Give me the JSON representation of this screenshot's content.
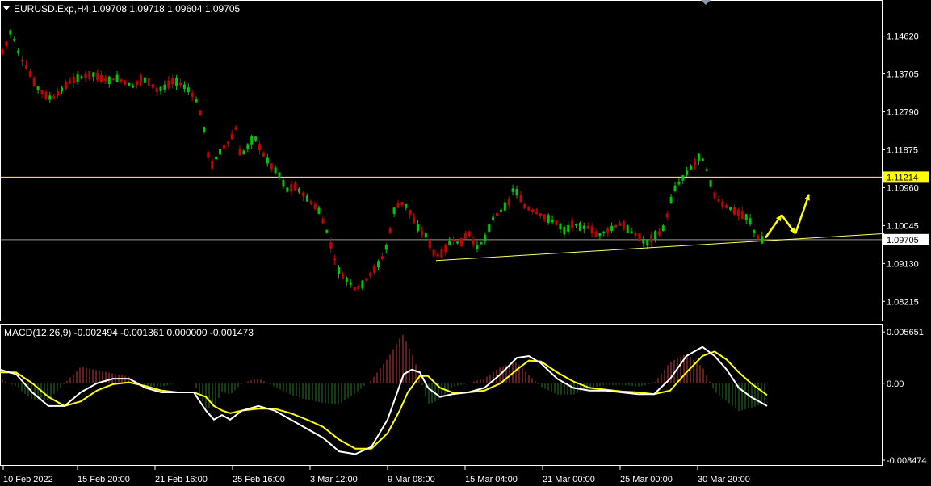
{
  "window": {
    "symbol_header": "EURUSD.Exp,H4  1.09708 1.09718 1.09604 1.09705",
    "macd_header": "MACD(12,26,9) -0.002494 -0.001361 0.000000 -0.001473"
  },
  "colors": {
    "background": "#000000",
    "bull": "#00c800",
    "bear": "#c80000",
    "support_line": "#ffff66",
    "resistance_line": "#ffff66",
    "current_price_line": "#9a9a9a",
    "arrow": "#ffff00",
    "macd_line": "#ffffff",
    "signal_line": "#ffff00",
    "hist_pos": "#c83c3c",
    "hist_neg": "#287a28"
  },
  "icons": {
    "menu_arrow": "triangle-down-icon"
  },
  "chart_data": [
    {
      "type": "candlestick",
      "symbol": "EURUSD.Exp",
      "timeframe": "H4",
      "ohlc_last": {
        "open": 1.09708,
        "high": 1.09718,
        "low": 1.09604,
        "close": 1.09705
      },
      "ylim": [
        1.0785,
        1.151
      ],
      "y_ticks": [
        "1.14620",
        "1.13705",
        "1.12790",
        "1.11875",
        "1.10960",
        "1.10045",
        "1.09130",
        "1.08215"
      ],
      "x_ticks": [
        "10 Feb 2022",
        "15 Feb 20:00",
        "21 Feb 16:00",
        "25 Feb 16:00",
        "3 Mar 12:00",
        "9 Mar 08:00",
        "15 Mar 04:00",
        "21 Mar 00:00",
        "25 Mar 00:00",
        "30 Mar 20:00"
      ],
      "price_path": [
        [
          0,
          1.143
        ],
        [
          5,
          1.142
        ],
        [
          10,
          1.146
        ],
        [
          15,
          1.148
        ],
        [
          18,
          1.145
        ],
        [
          25,
          1.141
        ],
        [
          35,
          1.138
        ],
        [
          45,
          1.134
        ],
        [
          55,
          1.132
        ],
        [
          65,
          1.131
        ],
        [
          75,
          1.133
        ],
        [
          85,
          1.135
        ],
        [
          95,
          1.136
        ],
        [
          105,
          1.1365
        ],
        [
          115,
          1.137
        ],
        [
          125,
          1.136
        ],
        [
          135,
          1.1355
        ],
        [
          145,
          1.136
        ],
        [
          155,
          1.135
        ],
        [
          165,
          1.134
        ],
        [
          175,
          1.136
        ],
        [
          185,
          1.135
        ],
        [
          195,
          1.133
        ],
        [
          205,
          1.134
        ],
        [
          215,
          1.1355
        ],
        [
          225,
          1.1345
        ],
        [
          235,
          1.133
        ],
        [
          245,
          1.13
        ],
        [
          255,
          1.122
        ],
        [
          260,
          1.114
        ],
        [
          265,
          1.116
        ],
        [
          275,
          1.119
        ],
        [
          285,
          1.121
        ],
        [
          292,
          1.124
        ],
        [
          298,
          1.117
        ],
        [
          305,
          1.119
        ],
        [
          315,
          1.122
        ],
        [
          325,
          1.118
        ],
        [
          335,
          1.115
        ],
        [
          345,
          1.113
        ],
        [
          355,
          1.109
        ],
        [
          365,
          1.11
        ],
        [
          375,
          1.108
        ],
        [
          385,
          1.106
        ],
        [
          395,
          1.104
        ],
        [
          405,
          1.099
        ],
        [
          412,
          1.094
        ],
        [
          418,
          1.09
        ],
        [
          425,
          1.088
        ],
        [
          432,
          1.087
        ],
        [
          440,
          1.085
        ],
        [
          448,
          1.086
        ],
        [
          456,
          1.088
        ],
        [
          464,
          1.09
        ],
        [
          472,
          1.092
        ],
        [
          480,
          1.096
        ],
        [
          488,
          1.104
        ],
        [
          496,
          1.106
        ],
        [
          504,
          1.105
        ],
        [
          512,
          1.102
        ],
        [
          520,
          1.099
        ],
        [
          528,
          1.098
        ],
        [
          536,
          1.094
        ],
        [
          544,
          1.093
        ],
        [
          552,
          1.095
        ],
        [
          560,
          1.097
        ],
        [
          570,
          1.096
        ],
        [
          580,
          1.099
        ],
        [
          590,
          1.095
        ],
        [
          600,
          1.097
        ],
        [
          610,
          1.102
        ],
        [
          620,
          1.104
        ],
        [
          630,
          1.106
        ],
        [
          636,
          1.1095
        ],
        [
          642,
          1.108
        ],
        [
          650,
          1.105
        ],
        [
          660,
          1.104
        ],
        [
          670,
          1.103
        ],
        [
          680,
          1.102
        ],
        [
          690,
          1.101
        ],
        [
          700,
          1.099
        ],
        [
          710,
          1.101
        ],
        [
          720,
          1.1
        ],
        [
          730,
          1.1
        ],
        [
          740,
          1.098
        ],
        [
          750,
          1.099
        ],
        [
          760,
          1.1
        ],
        [
          770,
          1.101
        ],
        [
          780,
          1.099
        ],
        [
          790,
          1.098
        ],
        [
          800,
          1.096
        ],
        [
          810,
          1.098
        ],
        [
          820,
          1.099
        ],
        [
          828,
          1.104
        ],
        [
          834,
          1.109
        ],
        [
          842,
          1.111
        ],
        [
          850,
          1.113
        ],
        [
          858,
          1.115
        ],
        [
          866,
          1.117
        ],
        [
          872,
          1.116
        ],
        [
          878,
          1.112
        ],
        [
          884,
          1.108
        ],
        [
          892,
          1.106
        ],
        [
          900,
          1.105
        ],
        [
          910,
          1.104
        ],
        [
          920,
          1.103
        ],
        [
          928,
          1.102
        ],
        [
          936,
          1.098
        ],
        [
          944,
          1.097
        ]
      ],
      "horizontal_levels": [
        {
          "value": 1.11214,
          "label": "1.11214",
          "style": "resistance"
        },
        {
          "value": 1.09705,
          "label": "1.09705",
          "style": "current"
        }
      ],
      "trendline": {
        "start": [
          540,
          1.092
        ],
        "end": [
          1095,
          1.0985
        ]
      },
      "arrows": [
        [
          948,
          1.0975
        ],
        [
          968,
          1.103
        ],
        [
          985,
          1.0985
        ],
        [
          1002,
          1.108
        ]
      ]
    },
    {
      "type": "macd",
      "params": "MACD(12,26,9)",
      "values": {
        "macd": -0.002494,
        "signal": -0.001361,
        "zero": 0.0,
        "histogram": -0.001473
      },
      "ylim": [
        -0.009,
        0.0062
      ],
      "y_ticks": [
        "0.005651",
        "0.00",
        "-0.008474"
      ],
      "macd_path": [
        [
          0,
          0.0015
        ],
        [
          20,
          0.001
        ],
        [
          40,
          -0.001
        ],
        [
          60,
          -0.0025
        ],
        [
          80,
          -0.0025
        ],
        [
          100,
          -0.001
        ],
        [
          120,
          0.0
        ],
        [
          140,
          0.0005
        ],
        [
          160,
          0.0005
        ],
        [
          180,
          -0.0005
        ],
        [
          200,
          -0.001
        ],
        [
          220,
          -0.001
        ],
        [
          240,
          -0.001
        ],
        [
          255,
          -0.003
        ],
        [
          265,
          -0.004
        ],
        [
          275,
          -0.0035
        ],
        [
          285,
          -0.004
        ],
        [
          300,
          -0.003
        ],
        [
          320,
          -0.0025
        ],
        [
          340,
          -0.003
        ],
        [
          360,
          -0.004
        ],
        [
          380,
          -0.005
        ],
        [
          400,
          -0.006
        ],
        [
          420,
          -0.0075
        ],
        [
          440,
          -0.0078
        ],
        [
          460,
          -0.007
        ],
        [
          480,
          -0.004
        ],
        [
          490,
          -0.0015
        ],
        [
          500,
          0.001
        ],
        [
          510,
          0.0015
        ],
        [
          520,
          0.0012
        ],
        [
          530,
          -0.0005
        ],
        [
          545,
          -0.0015
        ],
        [
          560,
          -0.0012
        ],
        [
          580,
          -0.001
        ],
        [
          600,
          -0.0005
        ],
        [
          620,
          0.001
        ],
        [
          640,
          0.0028
        ],
        [
          655,
          0.003
        ],
        [
          670,
          0.0022
        ],
        [
          690,
          0.0005
        ],
        [
          710,
          -0.0005
        ],
        [
          730,
          -0.0008
        ],
        [
          750,
          -0.0008
        ],
        [
          770,
          -0.001
        ],
        [
          790,
          -0.0012
        ],
        [
          810,
          -0.0012
        ],
        [
          830,
          0.0005
        ],
        [
          850,
          0.003
        ],
        [
          870,
          0.004
        ],
        [
          885,
          0.003
        ],
        [
          900,
          0.0015
        ],
        [
          915,
          -0.0005
        ],
        [
          930,
          -0.0015
        ],
        [
          950,
          -0.0025
        ]
      ],
      "signal_path": [
        [
          0,
          0.0012
        ],
        [
          20,
          0.0012
        ],
        [
          40,
          0.0
        ],
        [
          60,
          -0.0015
        ],
        [
          80,
          -0.0025
        ],
        [
          100,
          -0.002
        ],
        [
          120,
          -0.0008
        ],
        [
          140,
          -0.0001
        ],
        [
          160,
          0.0001
        ],
        [
          180,
          -0.0003
        ],
        [
          200,
          -0.0008
        ],
        [
          220,
          -0.001
        ],
        [
          240,
          -0.001
        ],
        [
          255,
          -0.0015
        ],
        [
          265,
          -0.0025
        ],
        [
          275,
          -0.003
        ],
        [
          285,
          -0.0033
        ],
        [
          300,
          -0.003
        ],
        [
          320,
          -0.0028
        ],
        [
          340,
          -0.0028
        ],
        [
          360,
          -0.0033
        ],
        [
          380,
          -0.004
        ],
        [
          400,
          -0.0048
        ],
        [
          420,
          -0.0062
        ],
        [
          440,
          -0.0072
        ],
        [
          460,
          -0.0072
        ],
        [
          480,
          -0.0055
        ],
        [
          495,
          -0.003
        ],
        [
          505,
          -0.001
        ],
        [
          520,
          0.0008
        ],
        [
          530,
          0.0008
        ],
        [
          545,
          -0.0005
        ],
        [
          560,
          -0.001
        ],
        [
          580,
          -0.001
        ],
        [
          600,
          -0.0008
        ],
        [
          620,
          0.0
        ],
        [
          640,
          0.0015
        ],
        [
          655,
          0.0025
        ],
        [
          670,
          0.0024
        ],
        [
          690,
          0.0012
        ],
        [
          710,
          0.0002
        ],
        [
          730,
          -0.0005
        ],
        [
          750,
          -0.0007
        ],
        [
          770,
          -0.0009
        ],
        [
          790,
          -0.001
        ],
        [
          810,
          -0.0012
        ],
        [
          830,
          -0.0008
        ],
        [
          850,
          0.0012
        ],
        [
          870,
          0.003
        ],
        [
          885,
          0.0035
        ],
        [
          900,
          0.0026
        ],
        [
          915,
          0.0012
        ],
        [
          930,
          0.0
        ],
        [
          950,
          -0.0013
        ]
      ]
    }
  ]
}
